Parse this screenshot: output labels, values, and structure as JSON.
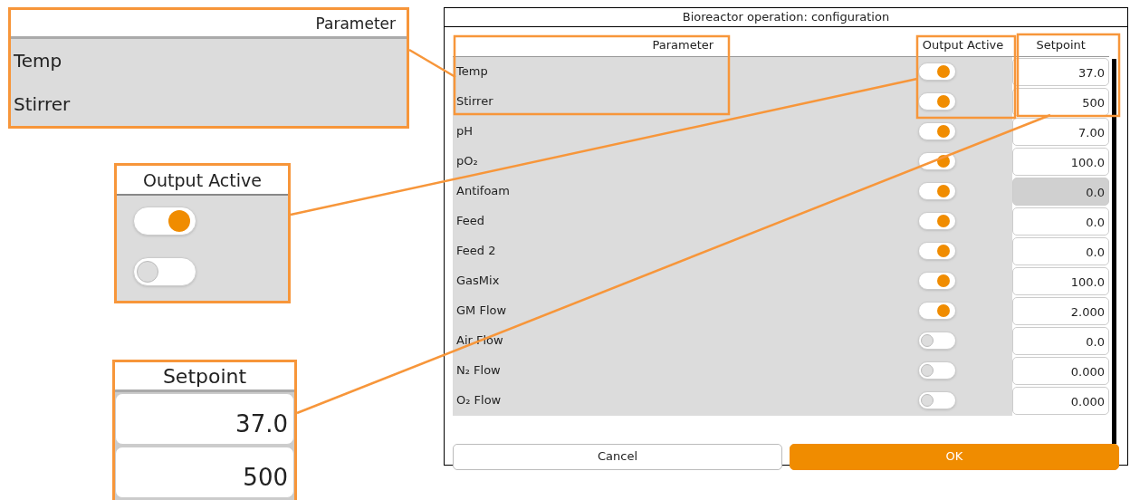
{
  "callouts": {
    "parameter": {
      "header": "Parameter",
      "rows": [
        "Temp",
        "Stirrer"
      ]
    },
    "output": {
      "header": "Output Active",
      "toggles": [
        {
          "on": true
        },
        {
          "on": false
        }
      ]
    },
    "setpoint": {
      "header": "Setpoint",
      "values": [
        "37.0",
        "500"
      ]
    }
  },
  "dialog": {
    "title": "Bioreactor operation: configuration",
    "columns": [
      "Parameter",
      "Output Active",
      "Setpoint"
    ],
    "rows": [
      {
        "parameter": "Temp",
        "on": true,
        "setpoint": "37.0",
        "disabled": false
      },
      {
        "parameter": "Stirrer",
        "on": true,
        "setpoint": "500",
        "disabled": false
      },
      {
        "parameter": "pH",
        "on": true,
        "setpoint": "7.00",
        "disabled": false
      },
      {
        "parameter": "pO₂",
        "on": true,
        "setpoint": "100.0",
        "disabled": false
      },
      {
        "parameter": "Antifoam",
        "on": true,
        "setpoint": "0.0",
        "disabled": true
      },
      {
        "parameter": "Feed",
        "on": true,
        "setpoint": "0.0",
        "disabled": false
      },
      {
        "parameter": "Feed 2",
        "on": true,
        "setpoint": "0.0",
        "disabled": false
      },
      {
        "parameter": "GasMix",
        "on": true,
        "setpoint": "100.0",
        "disabled": false
      },
      {
        "parameter": "GM Flow",
        "on": true,
        "setpoint": "2.000",
        "disabled": false
      },
      {
        "parameter": "Air Flow",
        "on": false,
        "setpoint": "0.0",
        "disabled": false
      },
      {
        "parameter": "N₂ Flow",
        "on": false,
        "setpoint": "0.000",
        "disabled": false
      },
      {
        "parameter": "O₂ Flow",
        "on": false,
        "setpoint": "0.000",
        "disabled": false
      }
    ],
    "buttons": [
      {
        "label": "Cancel",
        "kind": "secondary"
      },
      {
        "label": "OK",
        "kind": "primary"
      }
    ]
  }
}
